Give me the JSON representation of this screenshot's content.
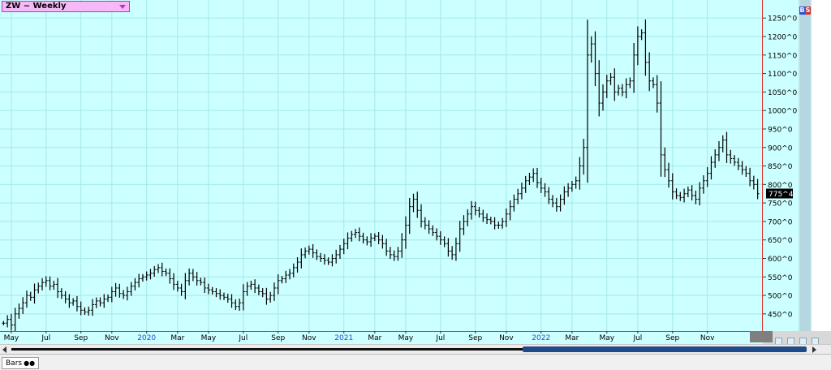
{
  "header": {
    "symbol_label": "ZW ~ Weekly"
  },
  "buttons": {
    "buy": "B",
    "sell": "S"
  },
  "bottom": {
    "bars_tab": "Bars"
  },
  "colors": {
    "background": "#ccffff",
    "grid": "#a6e8e8",
    "bars": "#000000",
    "axis_line": "#e03030",
    "year_label": "#1f4fd0",
    "last_price_bg": "#000000",
    "title_box": "#f6b8f6"
  },
  "chart_data": {
    "type": "bar",
    "title": "ZW ~ Weekly",
    "y_tick_labels": [
      "450^0",
      "500^0",
      "550^0",
      "600^0",
      "650^0",
      "700^0",
      "750^0",
      "800^0",
      "850^0",
      "900^0",
      "950^0",
      "1000^0",
      "1050^0",
      "1100^0",
      "1150^0",
      "1200^0",
      "1250^0"
    ],
    "y_tick_values": [
      450,
      500,
      550,
      600,
      650,
      700,
      750,
      800,
      850,
      900,
      950,
      1000,
      1050,
      1100,
      1150,
      1200,
      1250
    ],
    "ylim": [
      408,
      1290
    ],
    "last_price_label": "775^4",
    "last_price_value": 775.5,
    "grid": true,
    "x_tick_labels": [
      {
        "label": "May",
        "week": 2,
        "year": false
      },
      {
        "label": "Jul",
        "week": 11,
        "year": false
      },
      {
        "label": "Sep",
        "week": 20,
        "year": false
      },
      {
        "label": "Nov",
        "week": 28,
        "year": false
      },
      {
        "label": "2020",
        "week": 37,
        "year": true
      },
      {
        "label": "Mar",
        "week": 45,
        "year": false
      },
      {
        "label": "May",
        "week": 53,
        "year": false
      },
      {
        "label": "Jul",
        "week": 62,
        "year": false
      },
      {
        "label": "Sep",
        "week": 71,
        "year": false
      },
      {
        "label": "Nov",
        "week": 79,
        "year": false
      },
      {
        "label": "2021",
        "week": 88,
        "year": true
      },
      {
        "label": "Mar",
        "week": 96,
        "year": false
      },
      {
        "label": "May",
        "week": 104,
        "year": false
      },
      {
        "label": "Jul",
        "week": 113,
        "year": false
      },
      {
        "label": "Sep",
        "week": 122,
        "year": false
      },
      {
        "label": "Nov",
        "week": 130,
        "year": false
      },
      {
        "label": "2022",
        "week": 139,
        "year": true
      },
      {
        "label": "Mar",
        "week": 147,
        "year": false
      },
      {
        "label": "May",
        "week": 156,
        "year": false
      },
      {
        "label": "Jul",
        "week": 164,
        "year": false
      },
      {
        "label": "Sep",
        "week": 173,
        "year": false
      },
      {
        "label": "Nov",
        "week": 182,
        "year": false
      }
    ],
    "close_series": [
      425,
      435,
      420,
      450,
      465,
      480,
      500,
      495,
      515,
      525,
      535,
      540,
      525,
      530,
      510,
      500,
      490,
      480,
      485,
      470,
      460,
      455,
      460,
      475,
      485,
      480,
      490,
      495,
      510,
      520,
      505,
      500,
      510,
      525,
      535,
      545,
      550,
      555,
      560,
      570,
      575,
      565,
      560,
      545,
      530,
      520,
      510,
      540,
      560,
      550,
      540,
      535,
      520,
      515,
      510,
      505,
      500,
      495,
      490,
      480,
      470,
      480,
      510,
      525,
      530,
      520,
      510,
      505,
      490,
      500,
      520,
      540,
      545,
      555,
      560,
      575,
      590,
      610,
      620,
      625,
      615,
      605,
      600,
      595,
      590,
      600,
      610,
      625,
      640,
      655,
      665,
      670,
      660,
      650,
      645,
      655,
      660,
      650,
      640,
      620,
      610,
      605,
      620,
      650,
      690,
      740,
      760,
      730,
      700,
      690,
      680,
      670,
      660,
      650,
      640,
      620,
      610,
      640,
      680,
      700,
      720,
      740,
      730,
      720,
      710,
      705,
      700,
      690,
      690,
      700,
      720,
      740,
      760,
      775,
      790,
      810,
      820,
      830,
      805,
      790,
      780,
      760,
      750,
      740,
      760,
      780,
      790,
      800,
      810,
      850,
      900,
      1150,
      1180,
      1100,
      1020,
      1050,
      1080,
      1090,
      1050,
      1060,
      1050,
      1070,
      1080,
      1150,
      1200,
      1210,
      1130,
      1080,
      1070,
      1020,
      880,
      840,
      810,
      780,
      770,
      765,
      775,
      785,
      770,
      760,
      790,
      810,
      830,
      860,
      880,
      900,
      920,
      880,
      870,
      860,
      850,
      840,
      830,
      810,
      800,
      775
    ]
  }
}
